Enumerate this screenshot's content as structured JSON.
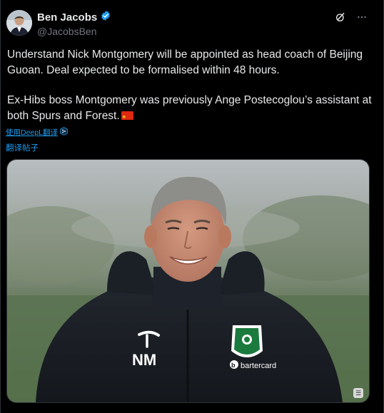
{
  "author": {
    "name": "Ben Jacobs",
    "handle": "@JacobsBen",
    "verified_color": "#1d9bf0"
  },
  "post": {
    "paragraph1": "Understand Nick Montgomery will be appointed as head coach of Beijing Guoan. Deal expected to be formalised within 48 hours.",
    "paragraph2": "Ex-Hibs boss Montgomery was previously Ange Postecoglou’s assistant at both Spurs and Forest."
  },
  "translation": {
    "deepl_label": "使用DeepL翻译",
    "translate_post": "翻译帖子"
  },
  "media": {
    "jacket_initials": "NM",
    "sponsor": "bartercard"
  },
  "icons": {
    "grok": "grok-icon",
    "more": "more-icon",
    "verified": "verified-icon",
    "deepl": "deepl-icon",
    "flag": "china-flag-icon"
  }
}
